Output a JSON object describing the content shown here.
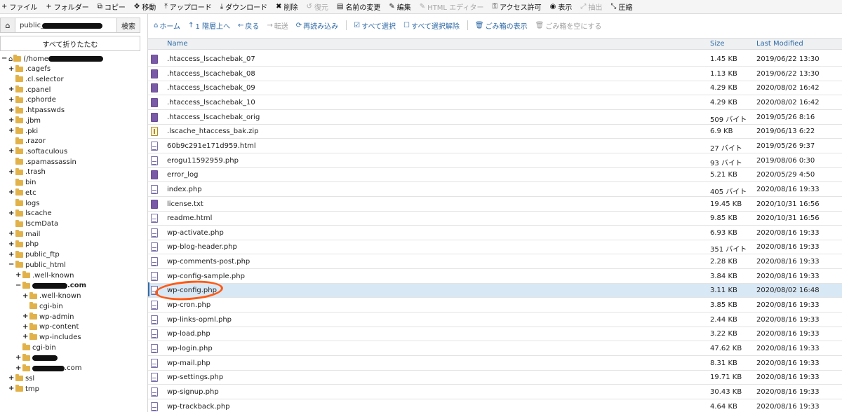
{
  "toolbar": {
    "items": [
      {
        "icon": "+",
        "label": "ファイル",
        "enabled": true
      },
      {
        "icon": "+",
        "label": "フォルダー",
        "enabled": true
      },
      {
        "icon": "⧉",
        "label": "コピー",
        "enabled": true
      },
      {
        "icon": "✥",
        "label": "移動",
        "enabled": true
      },
      {
        "icon": "⤒",
        "label": "アップロード",
        "enabled": true
      },
      {
        "icon": "⤓",
        "label": "ダウンロード",
        "enabled": true
      },
      {
        "icon": "✖",
        "label": "削除",
        "enabled": true
      },
      {
        "icon": "↺",
        "label": "復元",
        "enabled": false
      },
      {
        "icon": "▤",
        "label": "名前の変更",
        "enabled": true
      },
      {
        "icon": "✎",
        "label": "編集",
        "enabled": true
      },
      {
        "icon": "✎",
        "label": "HTML エディター",
        "enabled": false
      },
      {
        "icon": "⚿",
        "label": "アクセス許可",
        "enabled": true
      },
      {
        "icon": "◉",
        "label": "表示",
        "enabled": true
      },
      {
        "icon": "⤢",
        "label": "抽出",
        "enabled": false
      },
      {
        "icon": "⤡",
        "label": "圧縮",
        "enabled": true
      }
    ]
  },
  "left": {
    "path_value": "public_",
    "go_label": "検索",
    "collapse_label": "すべて折りたたむ",
    "tree": [
      {
        "label": "(/home",
        "depth": 0,
        "expander": "−",
        "redacted": 78,
        "home": true
      },
      {
        "label": ".cagefs",
        "depth": 1,
        "expander": "+"
      },
      {
        "label": ".cl.selector",
        "depth": 1,
        "expander": ""
      },
      {
        "label": ".cpanel",
        "depth": 1,
        "expander": "+"
      },
      {
        "label": ".cphorde",
        "depth": 1,
        "expander": "+"
      },
      {
        "label": ".htpasswds",
        "depth": 1,
        "expander": "+"
      },
      {
        "label": ".jbm",
        "depth": 1,
        "expander": "+"
      },
      {
        "label": ".pki",
        "depth": 1,
        "expander": "+"
      },
      {
        "label": ".razor",
        "depth": 1,
        "expander": ""
      },
      {
        "label": ".softaculous",
        "depth": 1,
        "expander": "+"
      },
      {
        "label": ".spamassassin",
        "depth": 1,
        "expander": ""
      },
      {
        "label": ".trash",
        "depth": 1,
        "expander": "+"
      },
      {
        "label": "bin",
        "depth": 1,
        "expander": ""
      },
      {
        "label": "etc",
        "depth": 1,
        "expander": "+"
      },
      {
        "label": "logs",
        "depth": 1,
        "expander": ""
      },
      {
        "label": "lscache",
        "depth": 1,
        "expander": "+"
      },
      {
        "label": "lscmData",
        "depth": 1,
        "expander": ""
      },
      {
        "label": "mail",
        "depth": 1,
        "expander": "+"
      },
      {
        "label": "php",
        "depth": 1,
        "expander": "+"
      },
      {
        "label": "public_ftp",
        "depth": 1,
        "expander": "+"
      },
      {
        "label": "public_html",
        "depth": 1,
        "expander": "−"
      },
      {
        "label": ".well-known",
        "depth": 2,
        "expander": "+"
      },
      {
        "label": ".com",
        "depth": 2,
        "expander": "−",
        "redacted": 50,
        "bold": true
      },
      {
        "label": ".well-known",
        "depth": 3,
        "expander": "+"
      },
      {
        "label": "cgi-bin",
        "depth": 3,
        "expander": ""
      },
      {
        "label": "wp-admin",
        "depth": 3,
        "expander": "+"
      },
      {
        "label": "wp-content",
        "depth": 3,
        "expander": "+"
      },
      {
        "label": "wp-includes",
        "depth": 3,
        "expander": "+"
      },
      {
        "label": "cgi-bin",
        "depth": 2,
        "expander": ""
      },
      {
        "label": "",
        "depth": 2,
        "expander": "+",
        "redacted": 36
      },
      {
        "label": ".com",
        "depth": 2,
        "expander": "+",
        "redacted": 46
      },
      {
        "label": "ssl",
        "depth": 1,
        "expander": "+"
      },
      {
        "label": "tmp",
        "depth": 1,
        "expander": "+"
      }
    ]
  },
  "subbar": {
    "items": [
      {
        "icon": "⌂",
        "label": "ホーム",
        "enabled": true
      },
      {
        "icon": "↑",
        "label": "1 階層上へ",
        "enabled": true
      },
      {
        "icon": "←",
        "label": "戻る",
        "enabled": true
      },
      {
        "icon": "→",
        "label": "転送",
        "enabled": false
      },
      {
        "icon": "⟳",
        "label": "再読み込み",
        "enabled": true
      },
      {
        "icon": "☑",
        "label": "すべて選択",
        "enabled": true
      },
      {
        "icon": "☐",
        "label": "すべて選択解除",
        "enabled": true
      },
      {
        "icon": "🗑",
        "label": "ごみ箱の表示",
        "enabled": true
      },
      {
        "icon": "🗑",
        "label": "ごみ箱を空にする",
        "enabled": false
      }
    ]
  },
  "table": {
    "headers": {
      "name": "Name",
      "size": "Size",
      "modified": "Last Modified"
    },
    "rows": [
      {
        "name": ".htaccess_lscachebak_07",
        "size": "1.45 KB",
        "modified": "2019/06/22 13:30",
        "icon": "text"
      },
      {
        "name": ".htaccess_lscachebak_08",
        "size": "1.13 KB",
        "modified": "2019/06/22 13:30",
        "icon": "text"
      },
      {
        "name": ".htaccess_lscachebak_09",
        "size": "4.29 KB",
        "modified": "2020/08/02 16:42",
        "icon": "text"
      },
      {
        "name": ".htaccess_lscachebak_10",
        "size": "4.29 KB",
        "modified": "2020/08/02 16:42",
        "icon": "text"
      },
      {
        "name": ".htaccess_lscachebak_orig",
        "size": "509 バイト",
        "modified": "2019/05/26 8:16",
        "icon": "text"
      },
      {
        "name": ".lscache_htaccess_bak.zip",
        "size": "6.9 KB",
        "modified": "2019/06/13 6:22",
        "icon": "zip"
      },
      {
        "name": "60b9c291e171d959.html",
        "size": "27 バイト",
        "modified": "2019/05/26 9:37",
        "icon": "wp"
      },
      {
        "name": "erogu11592959.php",
        "size": "93 バイト",
        "modified": "2019/08/06 0:30",
        "icon": "wp"
      },
      {
        "name": "error_log",
        "size": "5.21 KB",
        "modified": "2020/05/29 4:50",
        "icon": "text"
      },
      {
        "name": "index.php",
        "size": "405 バイト",
        "modified": "2020/08/16 19:33",
        "icon": "wp"
      },
      {
        "name": "license.txt",
        "size": "19.45 KB",
        "modified": "2020/10/31 16:56",
        "icon": "text"
      },
      {
        "name": "readme.html",
        "size": "9.85 KB",
        "modified": "2020/10/31 16:56",
        "icon": "wp"
      },
      {
        "name": "wp-activate.php",
        "size": "6.93 KB",
        "modified": "2020/08/16 19:33",
        "icon": "wp"
      },
      {
        "name": "wp-blog-header.php",
        "size": "351 バイト",
        "modified": "2020/08/16 19:33",
        "icon": "wp"
      },
      {
        "name": "wp-comments-post.php",
        "size": "2.28 KB",
        "modified": "2020/08/16 19:33",
        "icon": "wp"
      },
      {
        "name": "wp-config-sample.php",
        "size": "3.84 KB",
        "modified": "2020/08/16 19:33",
        "icon": "wp"
      },
      {
        "name": "wp-config.php",
        "size": "3.11 KB",
        "modified": "2020/08/02 16:48",
        "icon": "wp",
        "selected": true
      },
      {
        "name": "wp-cron.php",
        "size": "3.85 KB",
        "modified": "2020/08/16 19:33",
        "icon": "wp"
      },
      {
        "name": "wp-links-opml.php",
        "size": "2.44 KB",
        "modified": "2020/08/16 19:33",
        "icon": "wp"
      },
      {
        "name": "wp-load.php",
        "size": "3.22 KB",
        "modified": "2020/08/16 19:33",
        "icon": "wp"
      },
      {
        "name": "wp-login.php",
        "size": "47.62 KB",
        "modified": "2020/08/16 19:33",
        "icon": "wp"
      },
      {
        "name": "wp-mail.php",
        "size": "8.31 KB",
        "modified": "2020/08/16 19:33",
        "icon": "wp"
      },
      {
        "name": "wp-settings.php",
        "size": "19.71 KB",
        "modified": "2020/08/16 19:33",
        "icon": "wp"
      },
      {
        "name": "wp-signup.php",
        "size": "30.43 KB",
        "modified": "2020/08/16 19:33",
        "icon": "wp"
      },
      {
        "name": "wp-trackback.php",
        "size": "4.64 KB",
        "modified": "2020/08/16 19:33",
        "icon": "wp"
      }
    ]
  },
  "colors": {
    "accent": "#2f6aa6",
    "highlight": "#ff5a14",
    "folder": "#e2b24a",
    "selected_row": "#d9e8f5"
  }
}
